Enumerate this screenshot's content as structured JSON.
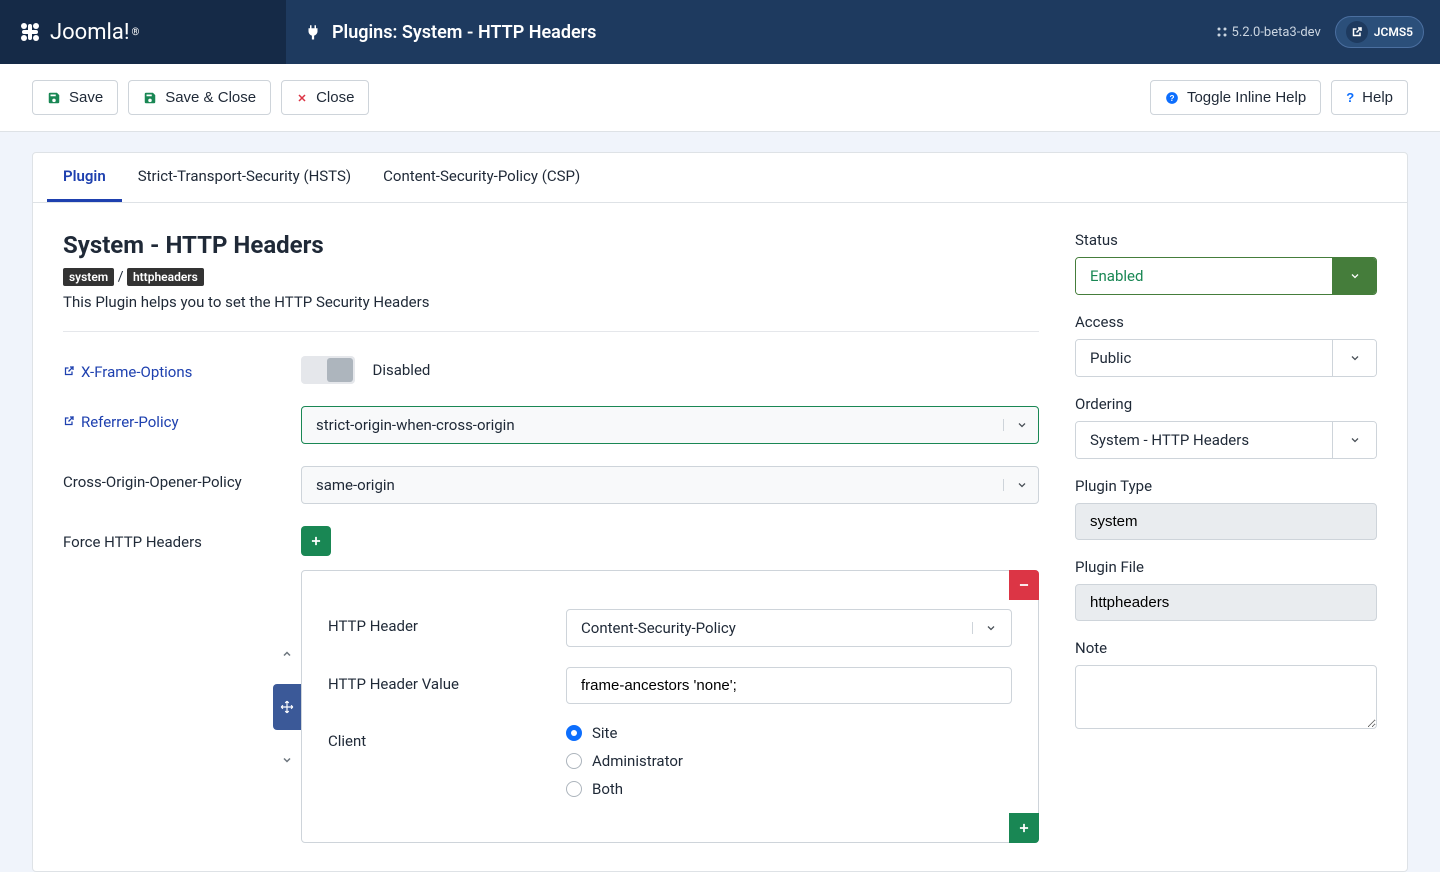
{
  "header": {
    "brand": "Joomla!",
    "title": "Plugins: System - HTTP Headers",
    "version": "5.2.0-beta3-dev",
    "site_badge": "JCMS5"
  },
  "toolbar": {
    "save": "Save",
    "save_close": "Save & Close",
    "close": "Close",
    "toggle_help": "Toggle Inline Help",
    "help": "Help"
  },
  "tabs": {
    "plugin": "Plugin",
    "hsts": "Strict-Transport-Security (HSTS)",
    "csp": "Content-Security-Policy (CSP)"
  },
  "plugin": {
    "title": "System - HTTP Headers",
    "tag_folder": "system",
    "tag_element": "httpheaders",
    "description": "This Plugin helps you to set the HTTP Security Headers",
    "xframe_label": "X-Frame-Options",
    "xframe_state": "Disabled",
    "referrer_label": "Referrer-Policy",
    "referrer_value": "strict-origin-when-cross-origin",
    "coop_label": "Cross-Origin-Opener-Policy",
    "coop_value": "same-origin",
    "force_label": "Force HTTP Headers"
  },
  "subform": {
    "header_label": "HTTP Header",
    "header_value_selected": "Content-Security-Policy",
    "value_label": "HTTP Header Value",
    "value_input": "frame-ancestors 'none';",
    "client_label": "Client",
    "client_options": {
      "site": "Site",
      "admin": "Administrator",
      "both": "Both"
    }
  },
  "sidebar": {
    "status_label": "Status",
    "status_value": "Enabled",
    "access_label": "Access",
    "access_value": "Public",
    "ordering_label": "Ordering",
    "ordering_value": "System - HTTP Headers",
    "type_label": "Plugin Type",
    "type_value": "system",
    "file_label": "Plugin File",
    "file_value": "httpheaders",
    "note_label": "Note"
  }
}
